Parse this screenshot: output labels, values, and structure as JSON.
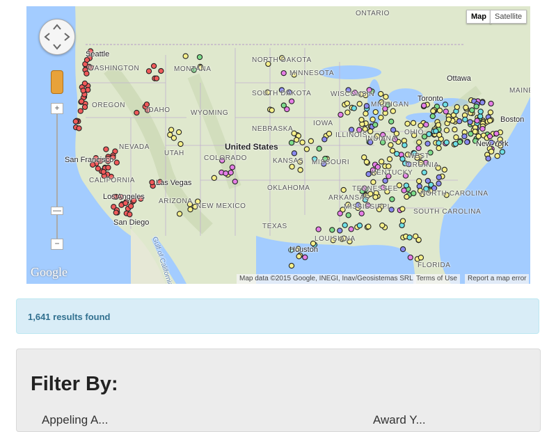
{
  "map": {
    "map_type_buttons": [
      "Map",
      "Satellite"
    ],
    "active_map_type": "Map",
    "google_logo_text": "Google",
    "attribution": "Map data ©2015 Google, INEGI, Inav/Geosistemas SRL",
    "terms_link": "Terms of Use",
    "report_link": "Report a map error",
    "zoom_in": "+",
    "zoom_out": "−",
    "country_label": "United States",
    "region_labels": [
      "ONTARIO",
      "NORTH DAKOTA",
      "SOUTH DAKOTA",
      "MINNESOTA",
      "WISCONSIN",
      "MICHIGAN",
      "MONTANA",
      "WASHINGTON",
      "OREGON",
      "IDAHO",
      "WYOMING",
      "NEBRASKA",
      "IOWA",
      "ILLINOIS",
      "INDIANA",
      "OHIO",
      "NEVADA",
      "UTAH",
      "COLORADO",
      "KANSAS",
      "MISSOURI",
      "KENTUCKY",
      "VIRGINIA",
      "CALIFORNIA",
      "ARIZONA",
      "NEW MEXICO",
      "OKLAHOMA",
      "ARKANSAS",
      "TENNESSEE",
      "MISSISSIPPI",
      "SOUTH CAROLINA",
      "NORTH CAROLINA",
      "TEXAS",
      "LOUISIANA",
      "FLORIDA",
      "MAINE",
      "WEST"
    ],
    "city_labels": [
      "Seattle",
      "Ottawa",
      "Toronto",
      "Boston",
      "New York",
      "San Francisco",
      "Las Vegas",
      "Los Angeles",
      "San Diego",
      "Houston"
    ],
    "water_labels": [
      "Gulf of California"
    ],
    "marker_colors": {
      "red": "#f05a5a",
      "yellow": "#f6f08a",
      "cyan": "#6fe0e6",
      "green": "#7ddc8a",
      "pink": "#e67ee6",
      "purple": "#8a8af0"
    },
    "water_color": "#a3ccff",
    "land_color": "#e6edd3"
  },
  "results": {
    "text": "1,641 results found",
    "bg_color": "#d9edf7",
    "text_color": "#31708f"
  },
  "filter": {
    "heading": "Filter By:",
    "columns": [
      "Appeling A...",
      "Award Y..."
    ]
  }
}
